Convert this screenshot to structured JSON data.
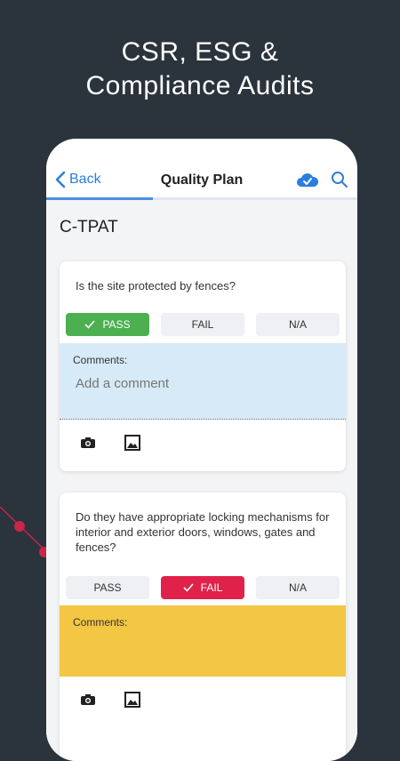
{
  "headline": {
    "line1": "CSR, ESG &",
    "line2": "Compliance Audits"
  },
  "navbar": {
    "back_label": "Back",
    "title": "Quality Plan"
  },
  "section": {
    "title": "C-TPAT"
  },
  "questions": [
    {
      "text": "Is the site protected by fences?",
      "buttons": {
        "pass": "PASS",
        "fail": "FAIL",
        "na": "N/A"
      },
      "selected": "pass",
      "comments_label": "Comments:",
      "comments_placeholder": "Add a comment",
      "comments_color": "#d6ebf7"
    },
    {
      "text": "Do they have appropriate locking mechanisms for interior and exterior doors, windows, gates and fences?",
      "buttons": {
        "pass": "PASS",
        "fail": "FAIL",
        "na": "N/A"
      },
      "selected": "fail",
      "comments_label": "Comments:",
      "comments_placeholder": "",
      "comments_color": "#f3c644"
    }
  ],
  "colors": {
    "background": "#2b333c",
    "accent": "#2a7de1",
    "pass": "#4caf50",
    "fail": "#e0224a",
    "decor": "#c8264a"
  },
  "icons": [
    "chevron-left-icon",
    "cloud-check-icon",
    "search-icon",
    "check-icon",
    "camera-icon",
    "image-icon"
  ]
}
